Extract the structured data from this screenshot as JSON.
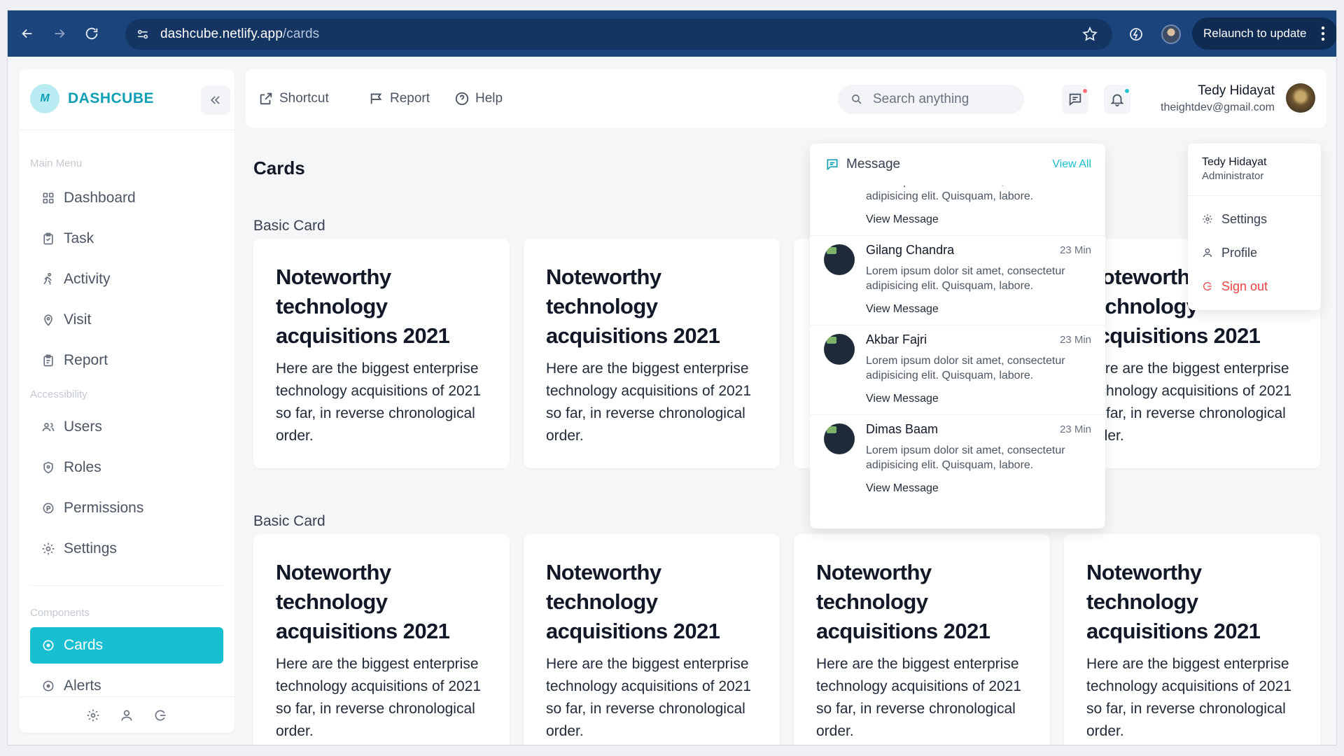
{
  "browser": {
    "url_host": "dashcube.netlify.app",
    "url_path": "/cards",
    "relaunch_label": "Relaunch to update"
  },
  "sidebar": {
    "brand_logo_text": "M",
    "brand_name": "DASHCUBE",
    "main_menu_label": "Main Menu",
    "accessibility_label": "Accessibility",
    "components_label": "Components",
    "main_items": [
      {
        "label": "Dashboard",
        "icon": "grid-icon"
      },
      {
        "label": "Task",
        "icon": "clipboard-icon"
      },
      {
        "label": "Activity",
        "icon": "running-icon"
      },
      {
        "label": "Visit",
        "icon": "map-pin-icon"
      },
      {
        "label": "Report",
        "icon": "clipboard-list-icon"
      }
    ],
    "access_items": [
      {
        "label": "Users",
        "icon": "users-icon"
      },
      {
        "label": "Roles",
        "icon": "shield-icon"
      },
      {
        "label": "Permissions",
        "icon": "permission-icon"
      },
      {
        "label": "Settings",
        "icon": "gear-icon"
      }
    ],
    "component_items": [
      {
        "label": "Cards",
        "icon": "circle-dot-icon",
        "active": true
      },
      {
        "label": "Alerts",
        "icon": "circle-dot-icon",
        "active": false
      }
    ]
  },
  "topbar": {
    "shortcut_label": "Shortcut",
    "report_label": "Report",
    "help_label": "Help",
    "search_placeholder": "Search anything",
    "message_dot_color": "#f87171",
    "notification_dot_color": "#22c3d6",
    "user_name": "Tedy Hidayat",
    "user_email": "theightdev@gmail.com"
  },
  "page": {
    "title": "Cards",
    "section1_title": "Basic Card",
    "section2_title": "Basic Card",
    "card_title": "Noteworthy technology acquisitions 2021",
    "card_text": "Here are the biggest enterprise technology acquisitions of 2021 so far, in reverse chronological order."
  },
  "messages": {
    "title": "Message",
    "view_all": "View All",
    "items": [
      {
        "name": "",
        "time": "",
        "body": "Lorem ipsum dolor sit amet, consectetur adipisicing elit. Quisquam, labore.",
        "link": "View Message"
      },
      {
        "name": "Gilang Chandra",
        "time": "23 Min",
        "body": "Lorem ipsum dolor sit amet, consectetur adipisicing elit. Quisquam, labore.",
        "link": "View Message"
      },
      {
        "name": "Akbar Fajri",
        "time": "23 Min",
        "body": "Lorem ipsum dolor sit amet, consectetur adipisicing elit. Quisquam, labore.",
        "link": "View Message"
      },
      {
        "name": "Dimas Baam",
        "time": "23 Min",
        "body": "Lorem ipsum dolor sit amet, consectetur adipisicing elit. Quisquam, labore.",
        "link": "View Message"
      }
    ]
  },
  "profile_menu": {
    "name": "Tedy Hidayat",
    "role": "Administrator",
    "settings": "Settings",
    "profile": "Profile",
    "sign_out": "Sign out"
  },
  "colors": {
    "accent": "#17bfd0",
    "browser_bar": "#1c447c",
    "danger": "#ef4444"
  }
}
